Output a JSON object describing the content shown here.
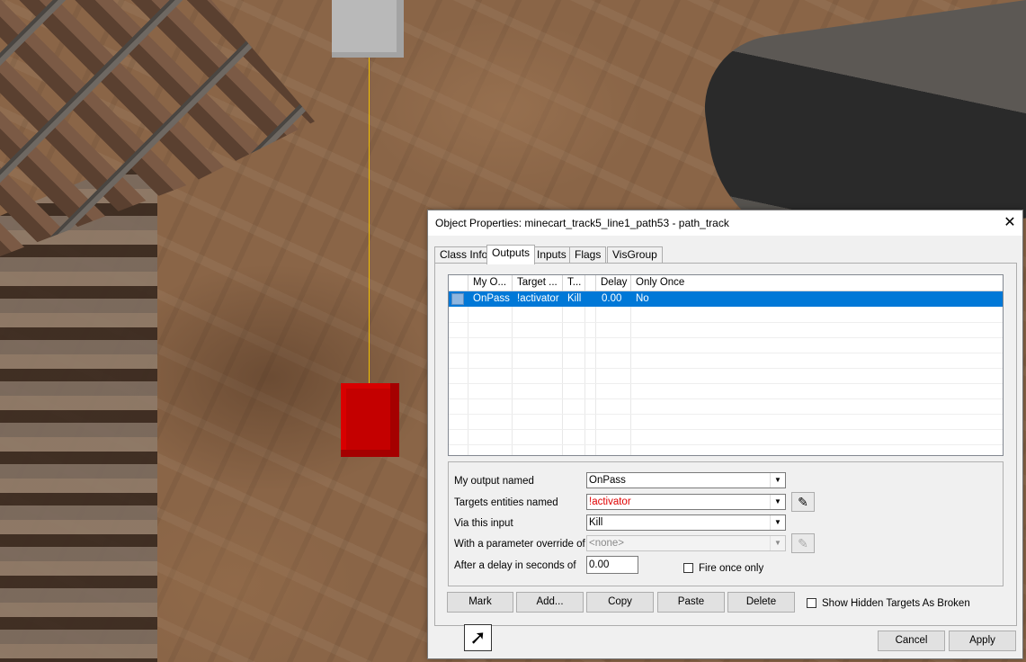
{
  "dialog": {
    "title": "Object Properties: minecart_track5_line1_path53 - path_track",
    "close_glyph": "✕"
  },
  "tabs": [
    "Class Info",
    "Outputs",
    "Inputs",
    "Flags",
    "VisGroup"
  ],
  "active_tab": "Outputs",
  "outputs_list": {
    "columns": [
      "My O...",
      "Target ...",
      "T...",
      "",
      "Delay",
      "Only Once"
    ],
    "rows": [
      {
        "my_output": "OnPass",
        "target": "!activator",
        "input": "Kill",
        "param": "",
        "delay": "0.00",
        "only_once": "No"
      }
    ]
  },
  "editor": {
    "my_output_label": "My output named",
    "my_output_value": "OnPass",
    "targets_label": "Targets entities named",
    "targets_value": "!activator",
    "targets_color": "#e00000",
    "via_input_label": "Via this input",
    "via_input_value": "Kill",
    "param_label": "With a parameter override of",
    "param_value": "<none>",
    "delay_label": "After a delay in seconds of",
    "delay_value": "0.00",
    "fire_once_label": "Fire once only"
  },
  "buttons": {
    "mark": "Mark",
    "add": "Add...",
    "copy": "Copy",
    "paste": "Paste",
    "delete": "Delete",
    "show_hidden_label": "Show Hidden Targets As Broken",
    "cancel": "Cancel",
    "apply": "Apply"
  },
  "icons": {
    "dropdown": "▼",
    "eyedropper": "✎",
    "output_tool": "➚"
  },
  "colors": {
    "selection": "#0078d7",
    "red_entity": "#c40000",
    "wire": "#f2c200"
  }
}
